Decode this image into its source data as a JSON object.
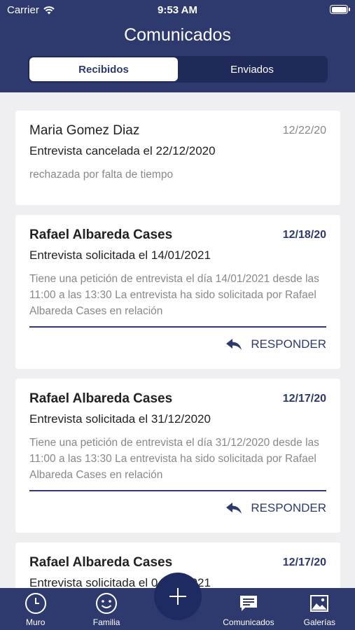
{
  "status_bar": {
    "carrier": "Carrier",
    "time": "9:53 AM"
  },
  "header": {
    "title": "Comunicados"
  },
  "segments": [
    {
      "label": "Recibidos",
      "active": true
    },
    {
      "label": "Enviados",
      "active": false
    }
  ],
  "messages": [
    {
      "sender": "Maria Gomez Diaz",
      "date": "12/22/20",
      "subject": "Entrevista cancelada el 22/12/2020",
      "body": "rechazada por falta de tiempo",
      "unread": false
    },
    {
      "sender": "Rafael Albareda Cases",
      "date": "12/18/20",
      "subject": "Entrevista solicitada el 14/01/2021",
      "body": "Tiene una petición de entrevista el día 14/01/2021 desde las 11:00 a las 13:30 La entrevista ha sido solicitada por Rafael Albareda Cases en relación",
      "unread": true,
      "action": "RESPONDER"
    },
    {
      "sender": "Rafael Albareda Cases",
      "date": "12/17/20",
      "subject": "Entrevista solicitada el 31/12/2020",
      "body": "Tiene una petición de entrevista el día 31/12/2020 desde las 11:00 a las 13:30 La entrevista ha sido solicitada por Rafael Albareda Cases en relación",
      "unread": true,
      "action": "RESPONDER"
    },
    {
      "sender": "Rafael Albareda Cases",
      "date": "12/17/20",
      "subject": "Entrevista solicitada el 04/01/2021",
      "unread": true
    }
  ],
  "tabbar": [
    {
      "label": "Muro",
      "icon": "clock-icon"
    },
    {
      "label": "Familia",
      "icon": "smiley-icon"
    },
    {
      "label": "Comunicados",
      "icon": "chat-icon"
    },
    {
      "label": "Galerías",
      "icon": "gallery-icon"
    }
  ],
  "fab": {
    "icon": "plus-icon"
  },
  "colors": {
    "primary": "#2e3a6e",
    "background": "#efeff1"
  }
}
